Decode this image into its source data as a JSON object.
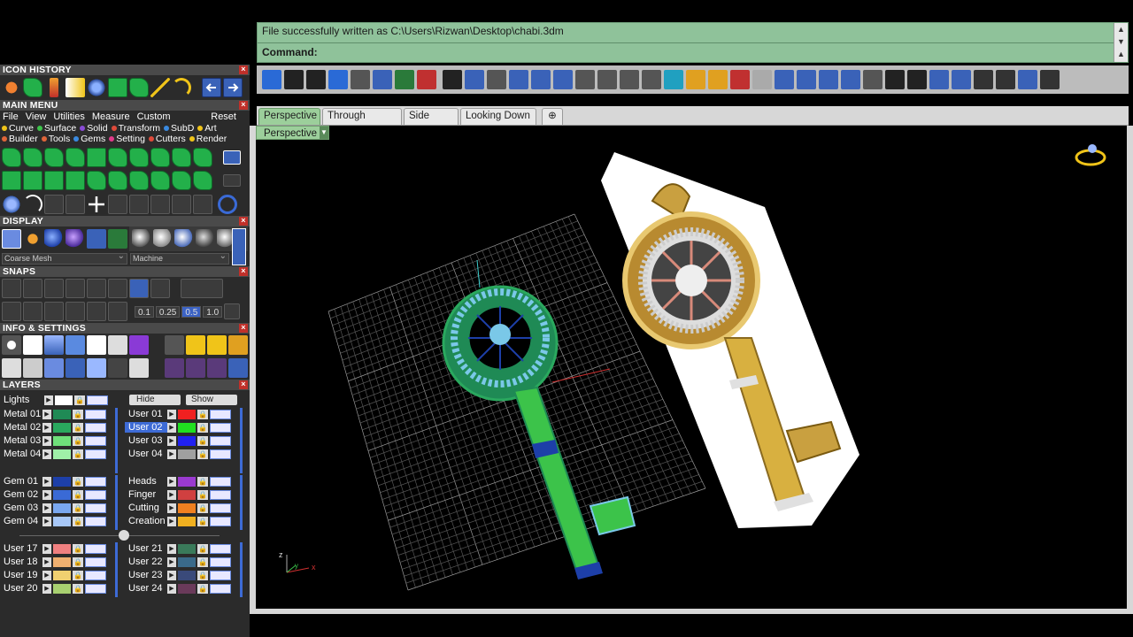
{
  "command_area": {
    "message": "File successfully written as C:\\Users\\Rizwan\\Desktop\\chabi.3dm",
    "prompt_label": "Command:"
  },
  "panels": {
    "icon_history": "ICON HISTORY",
    "main_menu": "MAIN MENU",
    "display": "DISPLAY",
    "snaps": "SNAPS",
    "info_settings": "INFO & SETTINGS",
    "layers": "LAYERS",
    "close_glyph": "×"
  },
  "main_menu": {
    "items": [
      "File",
      "View",
      "Utilities",
      "Measure",
      "Custom"
    ],
    "reset": "Reset",
    "categories_row1": [
      {
        "label": "Curve",
        "color": "#f0c419"
      },
      {
        "label": "Surface",
        "color": "#3cc34a"
      },
      {
        "label": "Solid",
        "color": "#8a4bd6"
      },
      {
        "label": "Transform",
        "color": "#e04a3a"
      },
      {
        "label": "SubD",
        "color": "#3a8ae0"
      },
      {
        "label": "Art",
        "color": "#f0c419"
      }
    ],
    "categories_row2": [
      {
        "label": "Builder",
        "color": "#e0663a"
      },
      {
        "label": "Tools",
        "color": "#e0663a"
      },
      {
        "label": "Gems",
        "color": "#3a8ae0"
      },
      {
        "label": "Setting",
        "color": "#e03a8a"
      },
      {
        "label": "Cutters",
        "color": "#e04a3a"
      },
      {
        "label": "Render",
        "color": "#f0c419"
      }
    ]
  },
  "display": {
    "mesh_select": "Coarse Mesh",
    "material_select": "Machine"
  },
  "snaps": {
    "values": [
      "0.1",
      "0.25",
      "0.5",
      "1.0"
    ],
    "active_value": "0.5"
  },
  "layers": {
    "lights": "Lights",
    "hide": "Hide",
    "show": "Show",
    "left_groups": [
      [
        {
          "name": "Metal 01",
          "color": "#1f8a55"
        },
        {
          "name": "Metal 02",
          "color": "#2aa85e"
        },
        {
          "name": "Metal 03",
          "color": "#6fe07a"
        },
        {
          "name": "Metal 04",
          "color": "#9ff0a8"
        }
      ],
      [
        {
          "name": "Gem 01",
          "color": "#1d3fa8"
        },
        {
          "name": "Gem 02",
          "color": "#3a6ad6"
        },
        {
          "name": "Gem 03",
          "color": "#7aa8f0"
        },
        {
          "name": "Gem 04",
          "color": "#a8c8f8"
        }
      ],
      [
        {
          "name": "User 17",
          "color": "#f08080"
        },
        {
          "name": "User 18",
          "color": "#f0b070"
        },
        {
          "name": "User 19",
          "color": "#f0d070"
        },
        {
          "name": "User 20",
          "color": "#a8d070"
        }
      ]
    ],
    "right_groups": [
      [
        {
          "name": "User 01",
          "color": "#f02020"
        },
        {
          "name": "User 02",
          "color": "#20e020",
          "highlight": true
        },
        {
          "name": "User 03",
          "color": "#2020f0"
        },
        {
          "name": "User 04",
          "color": "#a0a0a0"
        }
      ],
      [
        {
          "name": "Heads",
          "color": "#9a3ad0"
        },
        {
          "name": "Finger",
          "color": "#d04040"
        },
        {
          "name": "Cutting",
          "color": "#f08020"
        },
        {
          "name": "Creation",
          "color": "#f0b020"
        }
      ],
      [
        {
          "name": "User 21",
          "color": "#3a7a5a"
        },
        {
          "name": "User 22",
          "color": "#3a6a8a"
        },
        {
          "name": "User 23",
          "color": "#3a4a7a"
        },
        {
          "name": "User 24",
          "color": "#6a3a5a"
        }
      ]
    ]
  },
  "toolbar_icons": [
    "view-icon",
    "circle-icon",
    "curve-icon",
    "sweep-icon",
    "settings-icon",
    "p-icon",
    "surface-icon",
    "axis-icon",
    "monitor-icon",
    "cube-icon",
    "fe-icon",
    "mirror-icon",
    "split-icon",
    "globe-icon",
    "gems-icon",
    "dots-icon",
    "nodes-icon",
    "save-icon",
    "render-icon",
    "gear-icon",
    "grid-icon",
    "layers-icon",
    "disabled-icon",
    "arrow-up-icon",
    "arrow-down-icon",
    "arrow-updown-icon",
    "arrow-split-icon",
    "s-icon",
    "f4-icon",
    "x-icon",
    "cylinder-icon",
    "sphere-icon",
    "lock-icon",
    "unlock-icon",
    "ring-icon",
    "user-icon"
  ],
  "tabs": [
    "Perspective",
    "Through Finger",
    "Side View",
    "Looking Down"
  ],
  "active_tab": "Perspective",
  "viewport_label": "Perspective",
  "axis_labels": {
    "x": "x",
    "y": "y",
    "z": "z"
  }
}
